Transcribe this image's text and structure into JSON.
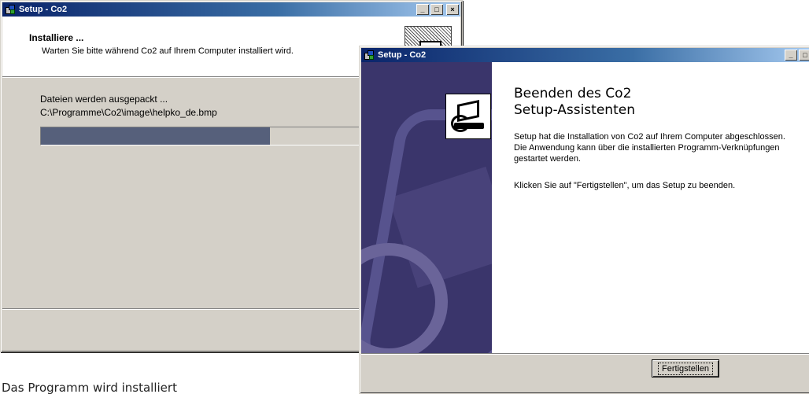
{
  "window1": {
    "title": "Setup - Co2",
    "header_title": "Installiere ...",
    "header_subtitle": "Warten Sie bitte während Co2 auf Ihrem Computer installiert wird.",
    "status_line1": "Dateien werden ausgepackt ...",
    "status_line2": "C:\\Programme\\Co2\\image\\helpko_de.bmp",
    "progress_fraction": 0.68,
    "controls": [
      "_",
      "□",
      "×"
    ]
  },
  "window2": {
    "title": "Setup - Co2",
    "heading_line1": "Beenden des Co2",
    "heading_line2": "Setup-Assistenten",
    "paragraph1": "Setup hat die Installation von Co2 auf Ihrem Computer abgeschlossen. Die Anwendung kann über die installierten Programm-Verknüpfungen gestartet werden.",
    "paragraph2": "Klicken Sie auf \"Fertigstellen\", um das Setup zu beenden.",
    "finish_button": "Fertigstellen",
    "controls": [
      "_",
      "□"
    ]
  },
  "caption": "Das Programm wird installiert",
  "colors": {
    "titlebar_start": "#0a246a",
    "progress_fill": "#56607b",
    "sidebar_bg": "#3a356b"
  }
}
